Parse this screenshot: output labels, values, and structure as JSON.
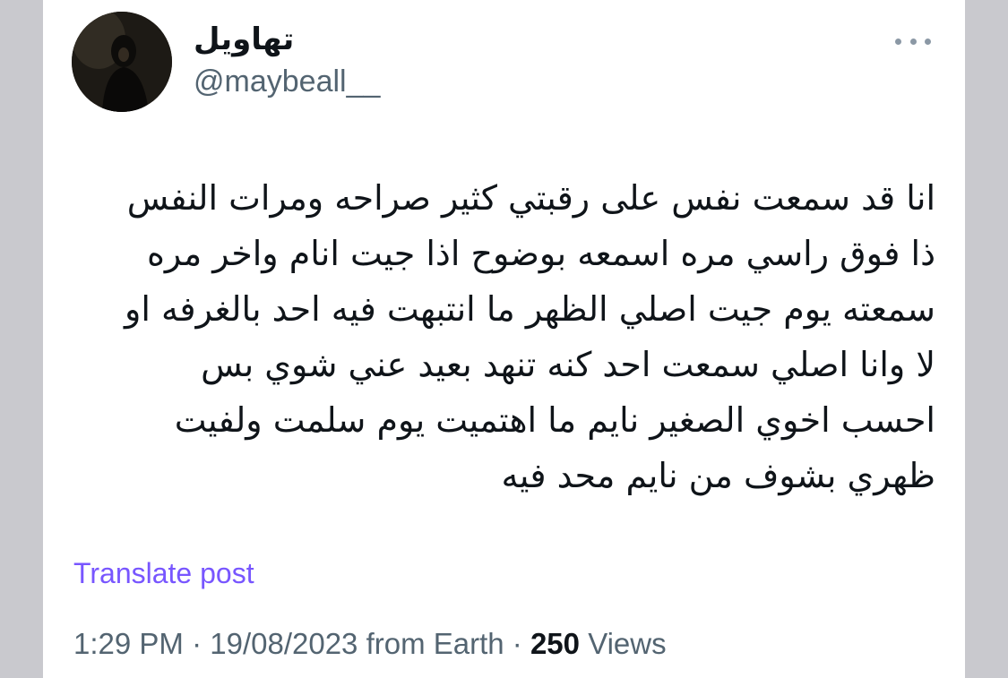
{
  "author": {
    "display_name": "تهاويل",
    "handle": "@maybeall__"
  },
  "tweet": {
    "lines": [
      "انا قد سمعت نفس على رقبتي كثير صراحه ومرات النفس",
      "ذا فوق راسي مره اسمعه بوضوح اذا جيت انام واخر مره",
      "سمعته يوم جيت اصلي الظهر ما انتبهت فيه احد بالغرفه او",
      "لا وانا اصلي سمعت احد كنه تنهد بعيد عني شوي بس",
      "احسب اخوي الصغير نايم ما اهتميت يوم سلمت ولفيت",
      "ظهري بشوف من نايم محد فيه"
    ],
    "translate_label": "Translate post"
  },
  "meta": {
    "time": "1:29 PM",
    "separator": " · ",
    "date": "19/08/2023",
    "source": "from Earth",
    "views_count": "250",
    "views_label": "Views"
  },
  "icons": {
    "more": "more-horizontal-icon"
  },
  "colors": {
    "text": "#0f1419",
    "secondary": "#536471",
    "translate": "#7856ff",
    "background": "#c9c9ce",
    "card": "#ffffff"
  }
}
